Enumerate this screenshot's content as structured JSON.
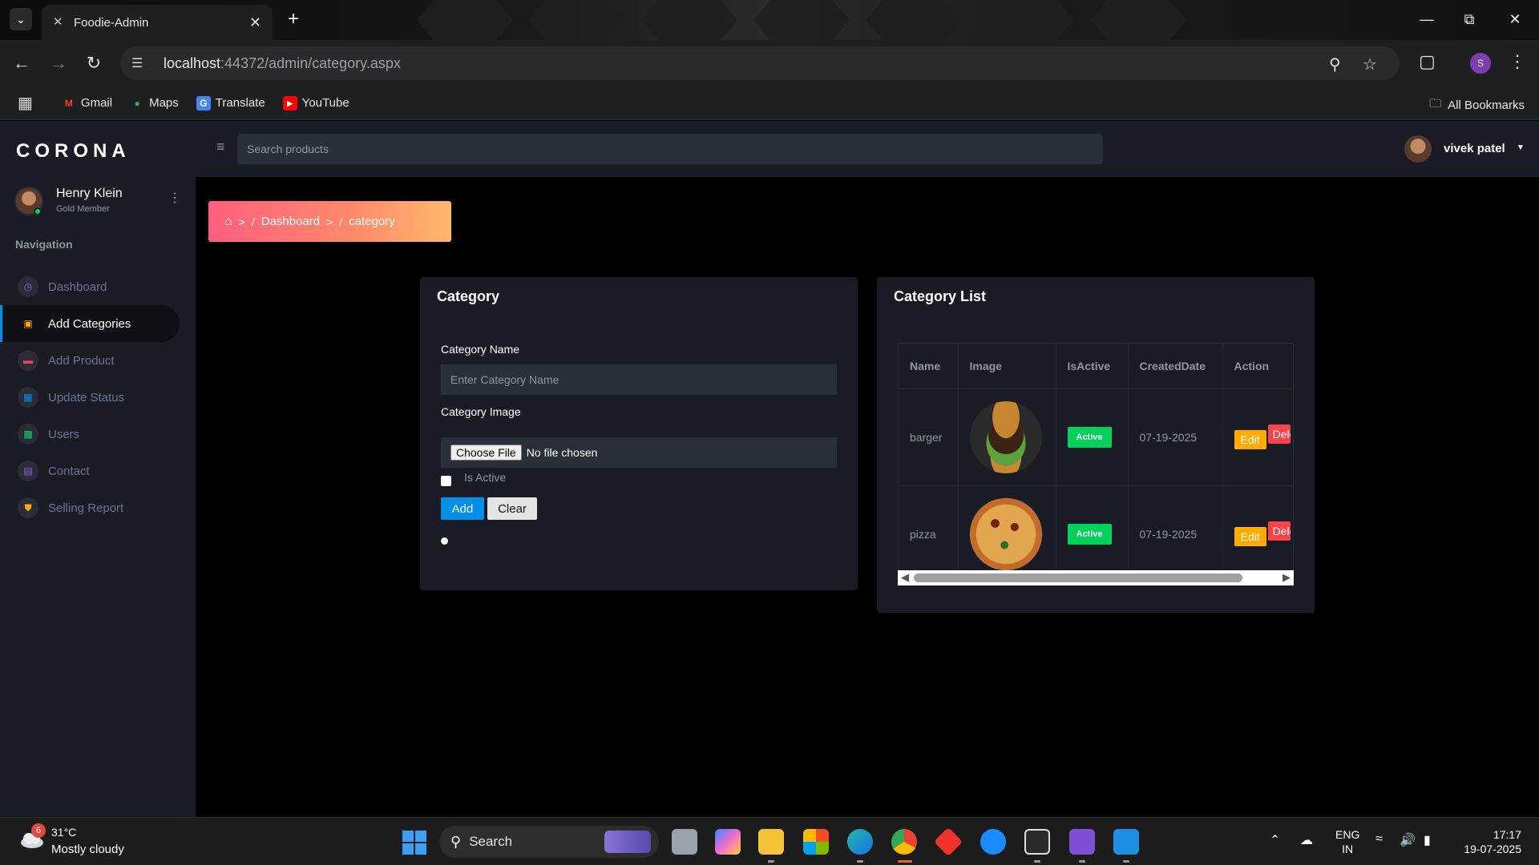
{
  "browser": {
    "tab_title": "Foodie-Admin",
    "url_host": "localhost",
    "url_rest": ":44372/admin/category.aspx",
    "profile_initial": "S",
    "bookmarks": [
      {
        "label": "Gmail",
        "icon": "gmail-icon",
        "color": "#ea4335"
      },
      {
        "label": "Maps",
        "icon": "maps-icon",
        "color": "#34a853"
      },
      {
        "label": "Translate",
        "icon": "translate-icon",
        "color": "#4285f4"
      },
      {
        "label": "YouTube",
        "icon": "youtube-icon",
        "color": "#ff0000"
      }
    ],
    "all_bookmarks": "All Bookmarks"
  },
  "sidebar": {
    "brand": "CORONA",
    "user_name": "Henry Klein",
    "user_role": "Gold Member",
    "nav_heading": "Navigation",
    "items": [
      {
        "label": "Dashboard",
        "icon": "speedometer-icon",
        "color": "#8f5fe8"
      },
      {
        "label": "Add Categories",
        "icon": "laptop-icon",
        "color": "#ffab00",
        "active": true
      },
      {
        "label": "Add Product",
        "icon": "playlist-icon",
        "color": "#fc424a"
      },
      {
        "label": "Update Status",
        "icon": "table-icon",
        "color": "#0090e7"
      },
      {
        "label": "Users",
        "icon": "chart-icon",
        "color": "#00d25b"
      },
      {
        "label": "Contact",
        "icon": "contacts-icon",
        "color": "#8f5fe8"
      },
      {
        "label": "Selling Report",
        "icon": "security-icon",
        "color": "#ffab00"
      }
    ]
  },
  "topbar": {
    "search_placeholder": "Search products",
    "user_name": "vivek patel"
  },
  "breadcrumb": {
    "items": [
      "Dashboard",
      "category"
    ]
  },
  "category_form": {
    "title": "Category",
    "name_label": "Category Name",
    "name_placeholder": "Enter Category Name",
    "image_label": "Category Image",
    "file_button": "Choose File",
    "file_status": "No file chosen",
    "is_active_label": "Is Active",
    "add_button": "Add",
    "clear_button": "Clear"
  },
  "category_list": {
    "title": "Category List",
    "columns": [
      "Name",
      "Image",
      "IsActive",
      "CreatedDate",
      "Action"
    ],
    "rows": [
      {
        "name": "barger",
        "image": "burger",
        "status": "Active",
        "created": "07-19-2025",
        "edit": "Edit",
        "delete": "Delete"
      },
      {
        "name": "pizza",
        "image": "pizza",
        "status": "Active",
        "created": "07-19-2025",
        "edit": "Edit",
        "delete": "Delete"
      }
    ]
  },
  "taskbar": {
    "weather_badge": "6",
    "temperature": "31°C",
    "weather": "Mostly cloudy",
    "search_label": "Search",
    "lang_top": "ENG",
    "lang_bottom": "IN",
    "time": "17:17",
    "date": "19-07-2025"
  }
}
